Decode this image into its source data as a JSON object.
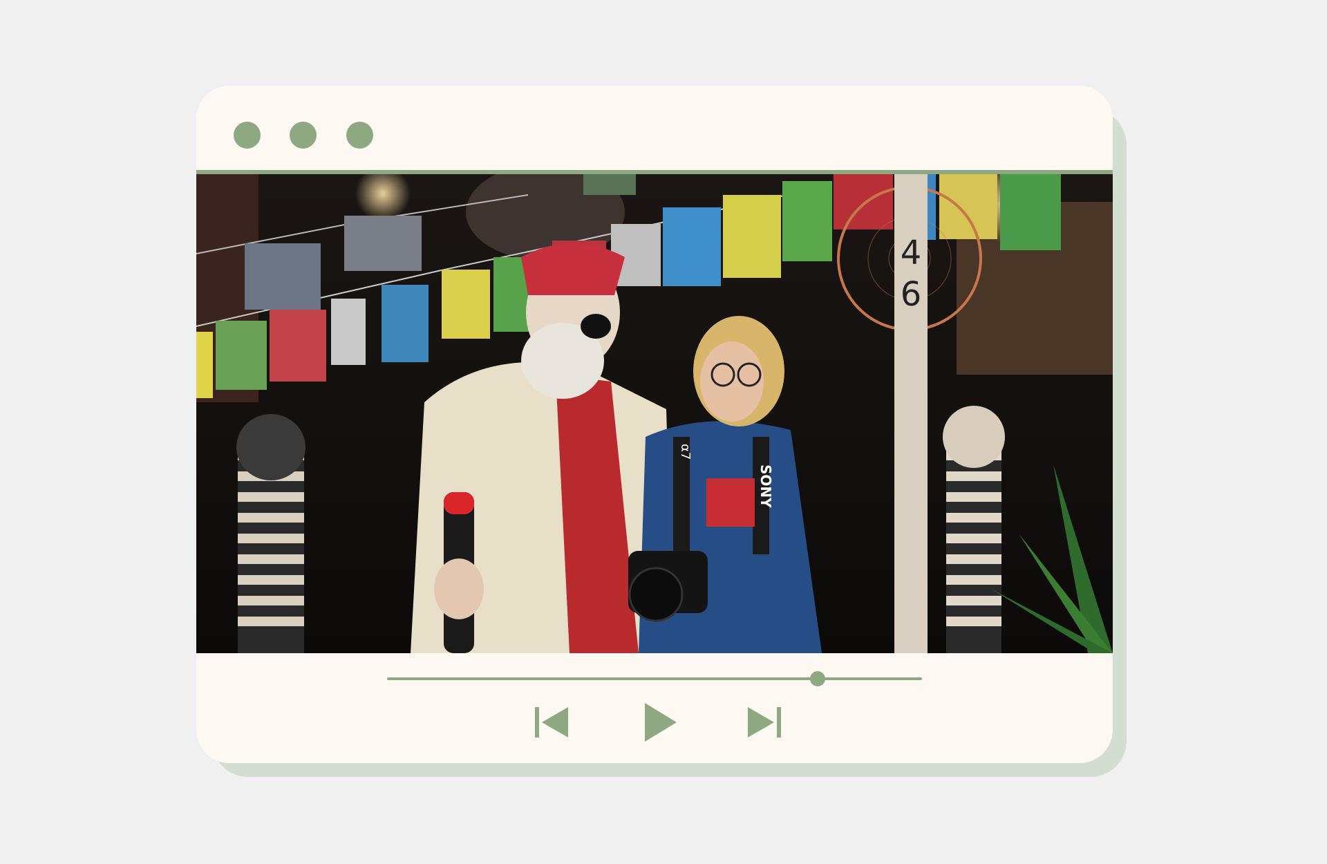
{
  "window": {
    "title": "",
    "traffic_lights": [
      "close",
      "minimize",
      "maximize"
    ]
  },
  "video": {
    "frame_labels": {
      "post_number_top": "4",
      "post_number_bottom": "6",
      "camera_strap_brand": "SONY",
      "camera_model": "α7"
    },
    "progress": 0.805
  },
  "controls": {
    "prev_icon": "skip-previous-icon",
    "play_icon": "play-icon",
    "next_icon": "skip-next-icon"
  },
  "colors": {
    "page_background": "#f0f0f0",
    "window_background": "#fdf8f2",
    "window_shadow": "#d3ddd0",
    "accent_green": "#8ea982"
  }
}
